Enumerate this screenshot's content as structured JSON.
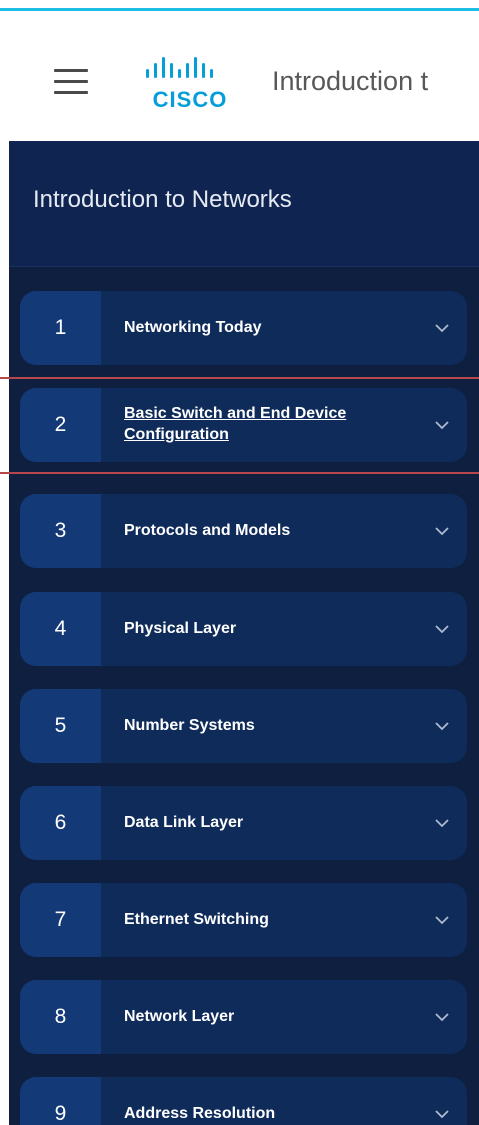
{
  "header": {
    "logo_text": "CISCO",
    "title": "Introduction t"
  },
  "sidebar": {
    "title": "Introduction to Networks",
    "modules": [
      {
        "number": "1",
        "label": "Networking Today"
      },
      {
        "number": "2",
        "label": "Basic Switch and End Device Configuration",
        "active": true
      },
      {
        "number": "3",
        "label": "Protocols and Models"
      },
      {
        "number": "4",
        "label": "Physical Layer"
      },
      {
        "number": "5",
        "label": "Number Systems"
      },
      {
        "number": "6",
        "label": "Data Link Layer"
      },
      {
        "number": "7",
        "label": "Ethernet Switching"
      },
      {
        "number": "8",
        "label": "Network Layer"
      },
      {
        "number": "9",
        "label": "Address Resolution"
      }
    ]
  },
  "colors": {
    "accent_line": "#1dbee6",
    "logo": "#049fd9",
    "sidebar_bg": "#0e1f3f",
    "module_bg": "#0f2b59",
    "highlight": "#b6474d"
  },
  "icons": {
    "menu": "hamburger-icon",
    "expand": "chevron-down-icon"
  }
}
